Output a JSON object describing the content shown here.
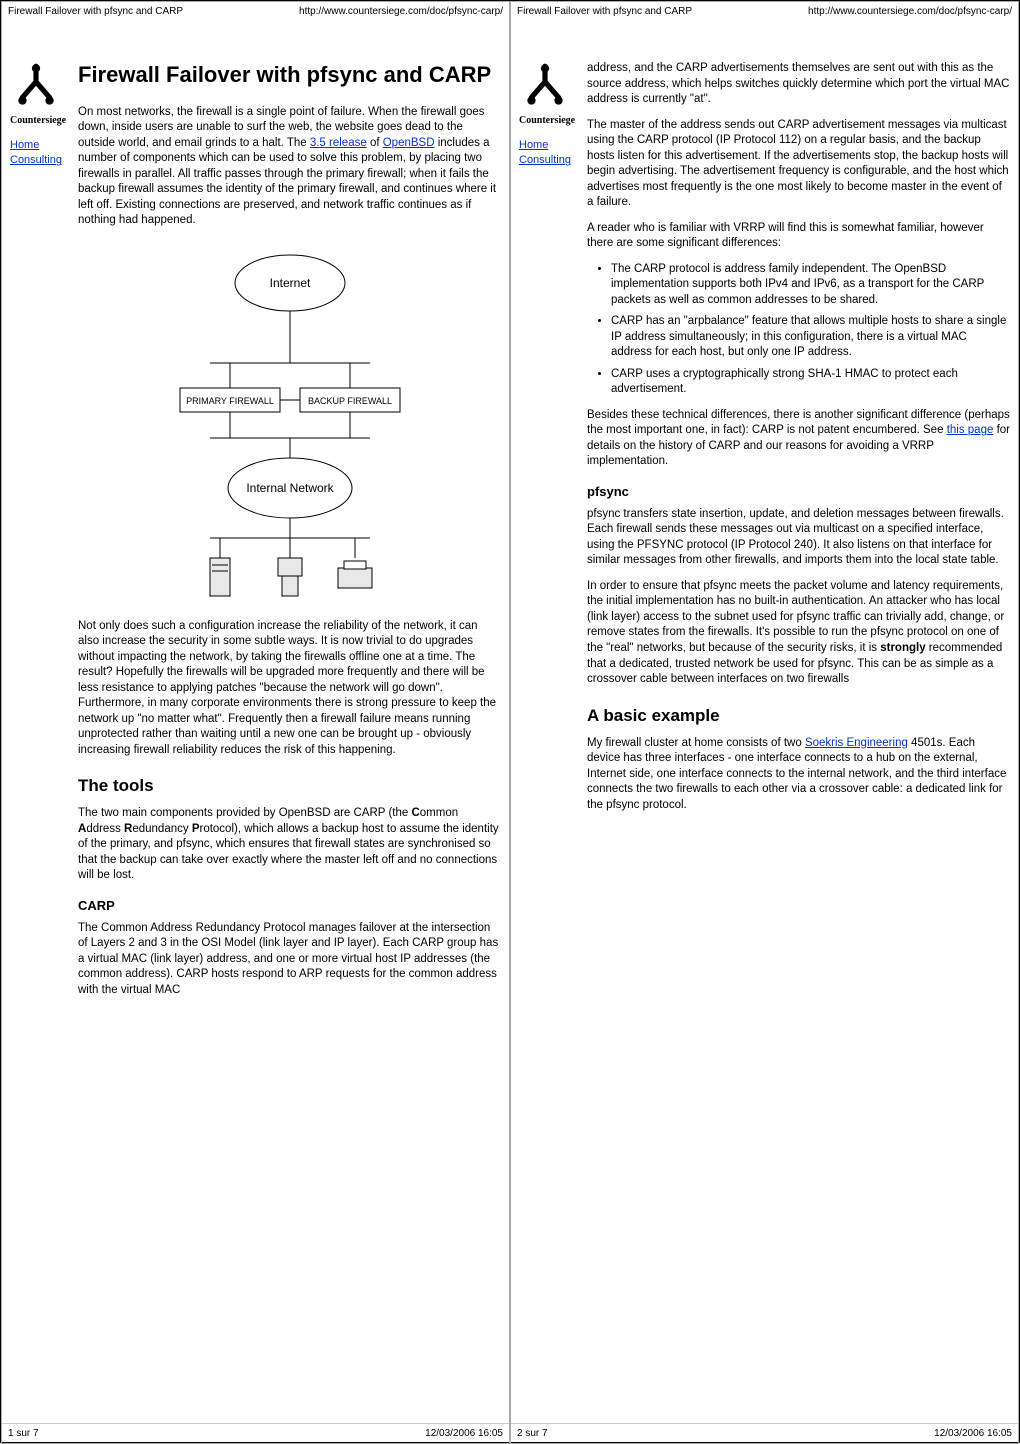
{
  "header": {
    "doc_title": "Firewall Failover with pfsync and CARP",
    "url": "http://www.countersiege.com/doc/pfsync-carp/"
  },
  "sidebar": {
    "brand": "Countersiege",
    "nav": [
      {
        "label": "Home"
      },
      {
        "label": "Consulting"
      }
    ]
  },
  "page1": {
    "title": "Firewall Failover with pfsync and CARP",
    "intro_1a": "On most networks, the firewall is a single point of failure. When the firewall goes down, inside users are unable to surf the web, the website goes dead to the outside world, and email grinds to a halt. The ",
    "link_35": "3.5 release",
    "intro_1b": " of ",
    "link_openbsd": "OpenBSD",
    "intro_1c": " includes a number of components which can be used to solve this problem, by placing two firewalls in parallel. All traffic passes through the primary firewall; when it fails the backup firewall assumes the identity of the primary firewall, and continues where it left off. Existing connections are preserved, and network traffic continues as if nothing had happened.",
    "diagram": {
      "internet": "Internet",
      "primary": "PRIMARY FIREWALL",
      "backup": "BACKUP FIREWALL",
      "internal": "Internal Network"
    },
    "para2": "Not only does such a configuration increase the reliability of the network, it can also increase the security in some subtle ways. It is now trivial to do upgrades without impacting the network, by taking the firewalls offline one at a time. The result? Hopefully the firewalls will be upgraded more frequently and there will be less resistance to applying patches \"because the network will go down\". Furthermore, in many corporate environments there is strong pressure to keep the network up \"no matter what\". Frequently then a firewall failure means running unprotected rather than waiting until a new one can be brought up - obviously increasing firewall reliability reduces the risk of this happening.",
    "h_tools": "The tools",
    "tools_intro_a": "The two main components provided by OpenBSD are CARP (the ",
    "b_c": "C",
    "t_ommon": "ommon ",
    "b_a": "A",
    "t_ddress": "ddress ",
    "b_r": "R",
    "t_edundancy": "edundancy ",
    "b_p": "P",
    "t_rotocol": "rotocol",
    "tools_intro_b": "), which allows a backup host to assume the identity of the primary, and pfsync, which ensures that firewall states are synchronised so that the backup can take over exactly where the master left off and no connections will be lost.",
    "h_carp": "CARP",
    "carp_para": "The Common Address Redundancy Protocol manages failover at the intersection of Layers 2 and 3 in the OSI Model (link layer and IP layer). Each CARP group has a virtual MAC (link layer) address, and one or more virtual host IP addresses (the common address). CARP hosts respond to ARP requests for the common address with the virtual MAC",
    "footer_left": "1 sur 7",
    "footer_right": "12/03/2006 16:05"
  },
  "page2": {
    "cont1": "address, and the CARP advertisements themselves are sent out with this as the source address, which helps switches quickly determine which port the virtual MAC address is currently \"at\".",
    "cont2": "The master of the address sends out CARP advertisement messages via multicast using the CARP protocol (IP Protocol 112) on a regular basis, and the backup hosts listen for this advertisement. If the advertisements stop, the backup hosts will begin advertising. The advertisement frequency is configurable, and the host which advertises most frequently is the one most likely to become master in the event of a failure.",
    "cont3": "A reader who is familiar with VRRP will find this is somewhat familiar, however there are some significant differences:",
    "bullets": [
      "The CARP protocol is address family independent. The OpenBSD implementation supports both IPv4 and IPv6, as a transport for the CARP packets as well as common addresses to be shared.",
      "CARP has an \"arpbalance\" feature that allows multiple hosts to share a single IP address simultaneously; in this configuration, there is a virtual MAC address for each host, but only one IP address.",
      "CARP uses a cryptographically strong SHA-1 HMAC to protect each advertisement."
    ],
    "cont4a": "Besides these technical differences, there is another significant difference (perhaps the most important one, in fact): CARP is not patent encumbered. See ",
    "link_thispage": "this page",
    "cont4b": " for details on the history of CARP and our reasons for avoiding a VRRP implementation.",
    "h_pfsync": "pfsync",
    "pfsync1": "pfsync transfers state insertion, update, and deletion messages between firewalls. Each firewall sends these messages out via multicast on a specified interface, using the PFSYNC protocol (IP Protocol 240). It also listens on that interface for similar messages from other firewalls, and imports them into the local state table.",
    "pfsync2_a": "In order to ensure that pfsync meets the packet volume and latency requirements, the initial implementation has no built-in authentication. An attacker who has local (link layer) access to the subnet used for pfsync traffic can trivially add, change, or remove states from the firewalls. It's possible to run the pfsync protocol on one of the \"real\" networks, but because of the security risks, it is ",
    "b_strongly": "strongly",
    "pfsync2_b": " recommended that a dedicated, trusted network be used for pfsync. This can be as simple as a crossover cable between interfaces on two firewalls",
    "h_example": "A basic example",
    "example_a": "My firewall cluster at home consists of two ",
    "link_soekris": "Soekris Engineering",
    "example_b": " 4501s. Each device has three interfaces - one interface connects to a hub on the external, Internet side, one interface connects to the internal network, and the third interface connects the two firewalls to each other via a crossover cable: a dedicated link for the pfsync protocol.",
    "footer_left": "2 sur 7",
    "footer_right": "12/03/2006 16:05"
  }
}
